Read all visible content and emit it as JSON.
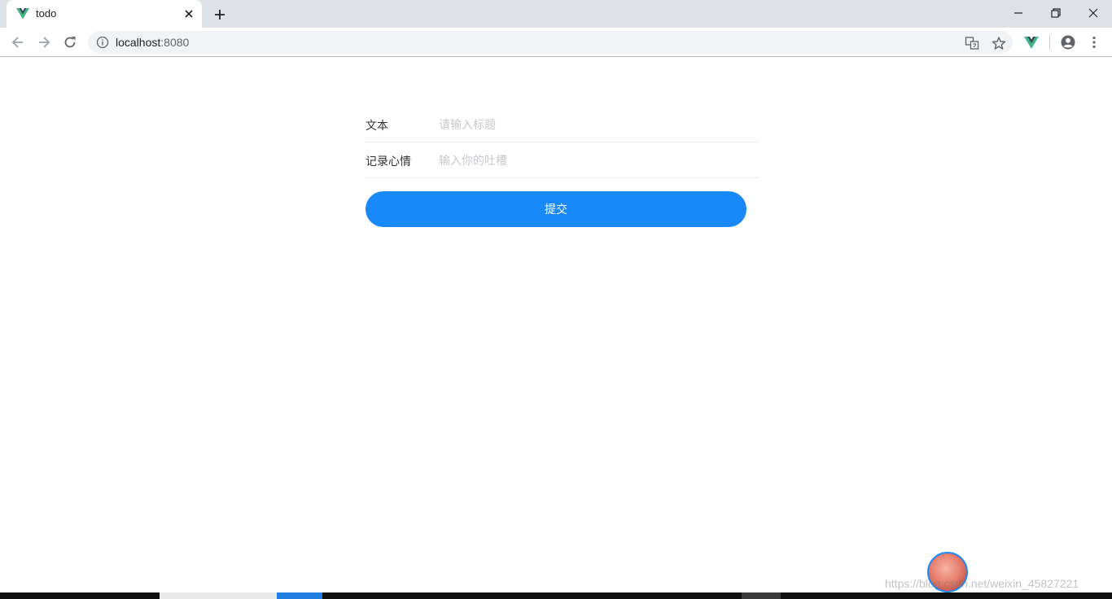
{
  "browser": {
    "tab_title": "todo",
    "url_host": "localhost",
    "url_port": ":8080"
  },
  "form": {
    "fields": [
      {
        "label": "文本",
        "placeholder": "请输入标题",
        "value": ""
      },
      {
        "label": "记录心情",
        "placeholder": "输入你的吐槽",
        "value": ""
      }
    ],
    "submit_label": "提交"
  },
  "watermark": "https://blog.csdn.net/weixin_45827221",
  "colors": {
    "accent": "#1989fa",
    "vue_green": "#41b883",
    "vue_dark": "#34495e"
  },
  "icons": [
    "vue-logo-icon",
    "close-icon",
    "plus-icon",
    "minimize-icon",
    "restore-icon",
    "back-arrow-icon",
    "forward-arrow-icon",
    "reload-icon",
    "info-icon",
    "translate-icon",
    "star-icon",
    "account-icon",
    "menu-dots-icon"
  ]
}
